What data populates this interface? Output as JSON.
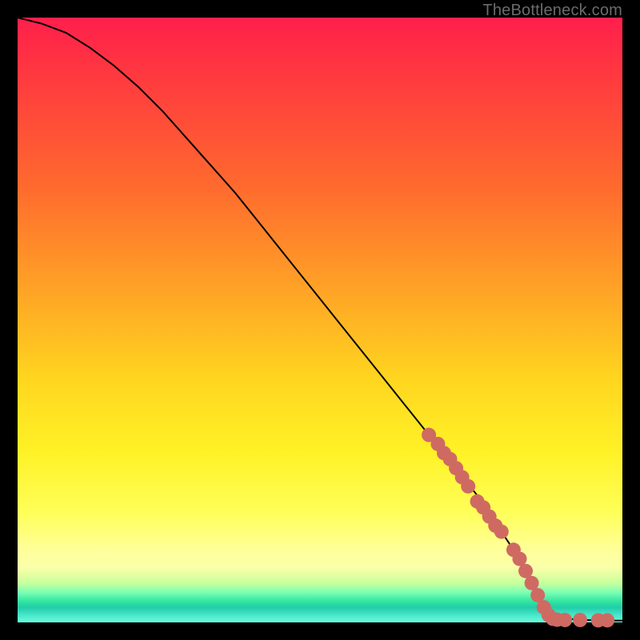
{
  "watermark": "TheBottleneck.com",
  "chart_data": {
    "type": "line",
    "title": "",
    "xlabel": "",
    "ylabel": "",
    "xlim": [
      0,
      100
    ],
    "ylim": [
      0,
      100
    ],
    "grid": false,
    "legend": false,
    "series": [
      {
        "name": "curve",
        "style": "line",
        "color": "#000000",
        "x": [
          0,
          4,
          8,
          12,
          16,
          20,
          24,
          28,
          32,
          36,
          40,
          44,
          48,
          52,
          56,
          60,
          64,
          68,
          72,
          76,
          80,
          82,
          84,
          85,
          86,
          88,
          90,
          92,
          94,
          96,
          98,
          100
        ],
        "values": [
          100,
          99,
          97.5,
          95,
          92,
          88.5,
          84.5,
          80,
          75.5,
          71,
          66,
          61,
          56,
          51,
          46,
          41,
          36,
          31,
          26,
          21,
          15,
          12,
          8,
          6,
          4,
          1.5,
          0.8,
          0.5,
          0.4,
          0.35,
          0.3,
          0.3
        ]
      },
      {
        "name": "dots",
        "style": "scatter",
        "color": "#cf6a63",
        "radius": 9,
        "x": [
          68,
          69.5,
          70.5,
          71.5,
          72.5,
          73.5,
          74.5,
          76,
          77,
          78,
          79,
          80,
          82,
          83,
          84,
          85,
          86,
          87,
          87.8,
          88.5,
          89.2,
          90.5,
          93,
          96,
          97.5
        ],
        "values": [
          31,
          29.5,
          28,
          27,
          25.5,
          24,
          22.5,
          20,
          19,
          17.5,
          16,
          15,
          12,
          10.5,
          8.5,
          6.5,
          4.5,
          2.5,
          1.2,
          0.6,
          0.45,
          0.4,
          0.4,
          0.35,
          0.35
        ]
      }
    ]
  }
}
